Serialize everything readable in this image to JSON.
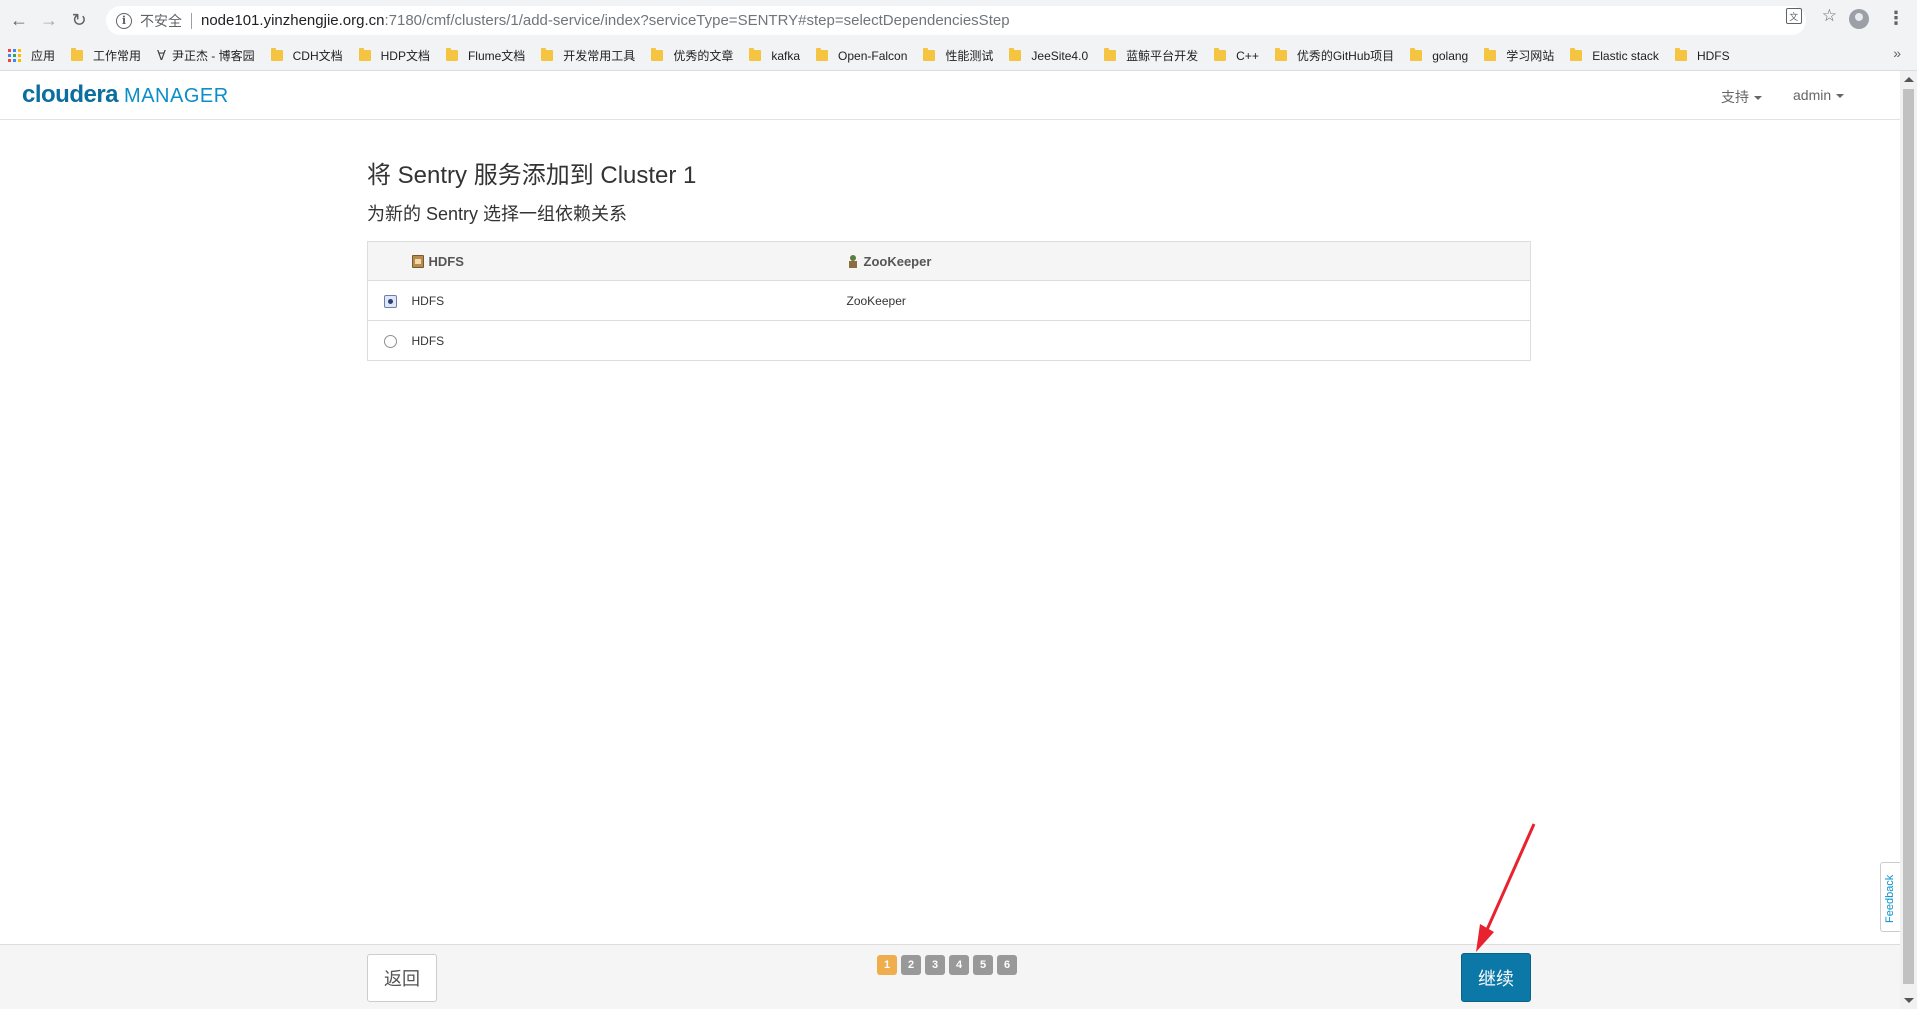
{
  "browser": {
    "security_label": "不安全",
    "url_host": "node101.yinzhengjie.org.cn",
    "url_path": ":7180/cmf/clusters/1/add-service/index?serviceType=SENTRY#step=selectDependenciesStep"
  },
  "bookmarks": {
    "apps": "应用",
    "items": [
      "工作常用",
      "尹正杰 - 博客园",
      "CDH文档",
      "HDP文档",
      "Flume文档",
      "开发常用工具",
      "优秀的文章",
      "kafka",
      "Open-Falcon",
      "性能测试",
      "JeeSite4.0",
      "蓝鲸平台开发",
      "C++",
      "优秀的GitHub项目",
      "golang",
      "学习网站",
      "Elastic stack",
      "HDFS"
    ]
  },
  "header": {
    "logo_main": "cloudera",
    "logo_sub": "MANAGER",
    "support_menu": "支持",
    "user_menu": "admin"
  },
  "main": {
    "title": "将 Sentry 服务添加到 Cluster 1",
    "subtitle": "为新的 Sentry 选择一组依赖关系",
    "table": {
      "headers": [
        "HDFS",
        "ZooKeeper"
      ],
      "rows": [
        {
          "hdfs": "HDFS",
          "zookeeper": "ZooKeeper",
          "selected": true
        },
        {
          "hdfs": "HDFS",
          "zookeeper": "",
          "selected": false
        }
      ]
    }
  },
  "footer": {
    "back_label": "返回",
    "continue_label": "继续",
    "steps": [
      "1",
      "2",
      "3",
      "4",
      "5",
      "6"
    ],
    "active_step": "1"
  },
  "feedback_label": "Feedback",
  "colors": {
    "primary": "#0b78a8",
    "active_step": "#f0ad4e",
    "annotation_arrow": "#e8232f"
  }
}
